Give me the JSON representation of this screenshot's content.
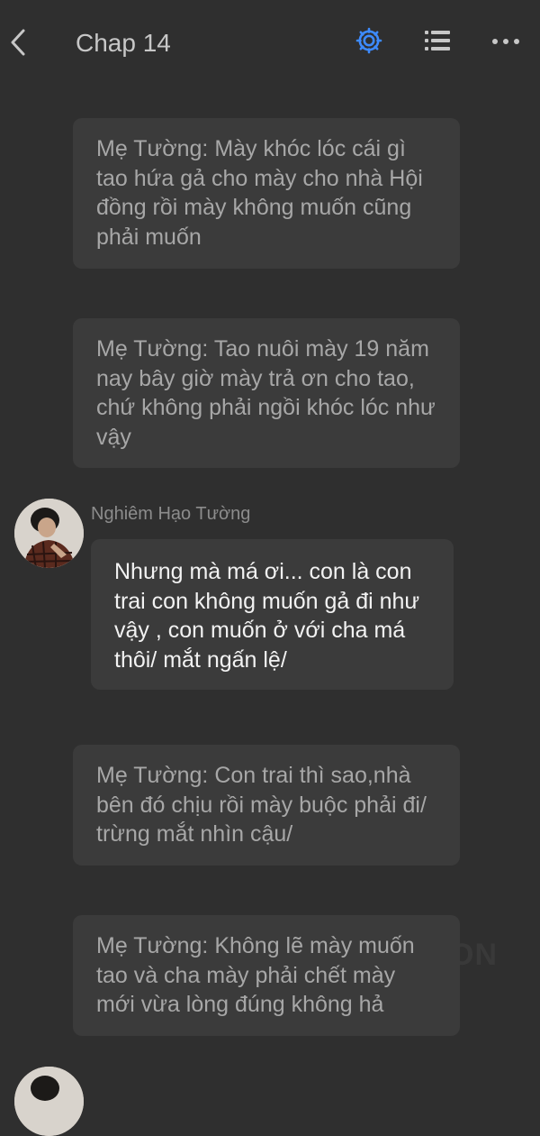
{
  "header": {
    "title": "Chap 14"
  },
  "colors": {
    "background": "#2f2f2f",
    "bubble": "#3b3b3b",
    "accent_gear": "#3d8bff"
  },
  "icons": {
    "back": "chevron-left-icon",
    "settings": "gear-icon",
    "chapters": "list-icon",
    "more": "more-horizontal-icon"
  },
  "messages": [
    {
      "type": "narration",
      "text": "Mẹ Tường: Mày khóc lóc cái gì tao hứa gả cho mày cho nhà Hội đồng rồi mày không muốn cũng phải muốn"
    },
    {
      "type": "narration",
      "text": "Mẹ Tường: Tao nuôi mày 19 năm nay bây giờ mày trả ơn cho tao, chứ không phải ngồi khóc lóc như vậy"
    },
    {
      "type": "character",
      "sender": "Nghiêm Hạo Tường",
      "text": "Nhưng mà má ơi... con là con trai con không muốn gả đi như vậy , con muốn ở với cha má thôi/ mắt ngấn lệ/"
    },
    {
      "type": "narration",
      "text": "Mẹ Tường: Con trai thì sao,nhà bên đó chịu rồi mày buộc phải đi/ trừng mắt nhìn cậu/"
    },
    {
      "type": "narration",
      "text": "Mẹ Tường: Không lẽ mày muốn tao và cha mày phải chết mày mới vừa lòng đúng không hả"
    }
  ],
  "watermark": "ON"
}
